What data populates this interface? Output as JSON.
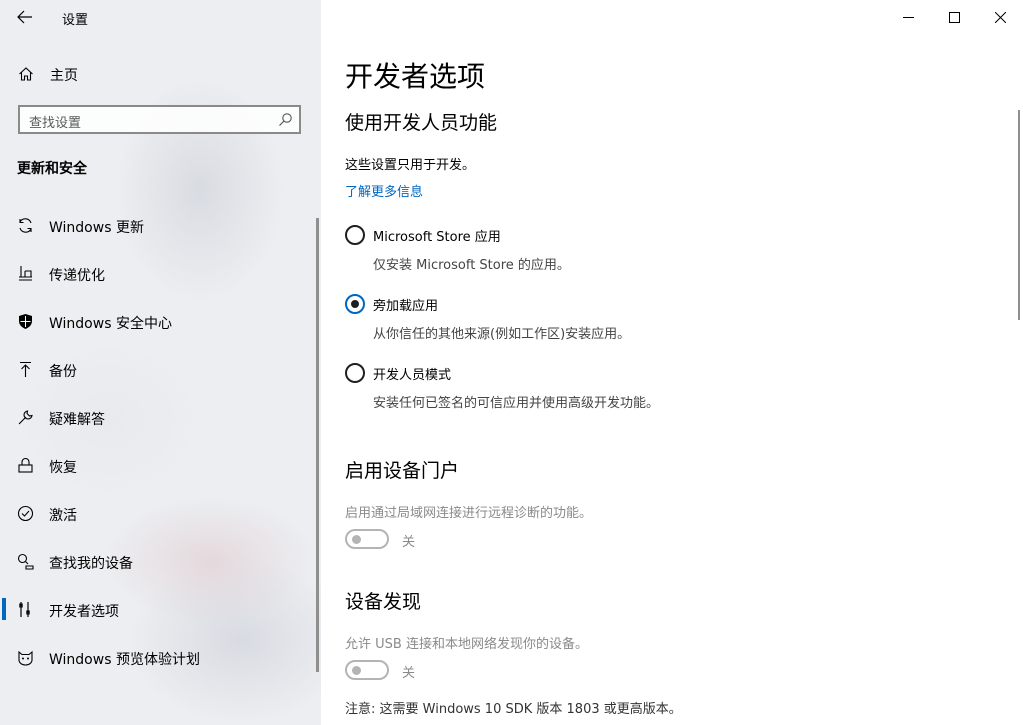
{
  "app": {
    "title": "设置"
  },
  "sidebar": {
    "home_label": "主页",
    "search_placeholder": "查找设置",
    "section_header": "更新和安全",
    "items": [
      {
        "label": "Windows 更新",
        "icon": "refresh-icon"
      },
      {
        "label": "传递优化",
        "icon": "delivery-optimization-icon"
      },
      {
        "label": "Windows 安全中心",
        "icon": "shield-icon"
      },
      {
        "label": "备份",
        "icon": "backup-upload-icon"
      },
      {
        "label": "疑难解答",
        "icon": "wrench-icon"
      },
      {
        "label": "恢复",
        "icon": "recovery-icon"
      },
      {
        "label": "激活",
        "icon": "check-circle-icon"
      },
      {
        "label": "查找我的设备",
        "icon": "find-device-icon"
      },
      {
        "label": "开发者选项",
        "icon": "developer-tools-icon",
        "active": true
      },
      {
        "label": "Windows 预览体验计划",
        "icon": "insider-cat-icon"
      }
    ]
  },
  "main": {
    "page_title": "开发者选项",
    "dev_section": {
      "heading": "使用开发人员功能",
      "description": "这些设置只用于开发。",
      "learn_more": "了解更多信息",
      "options": [
        {
          "label": "Microsoft Store 应用",
          "desc": "仅安装 Microsoft Store 的应用。",
          "checked": false
        },
        {
          "label": "旁加载应用",
          "desc": "从你信任的其他来源(例如工作区)安装应用。",
          "checked": true
        },
        {
          "label": "开发人员模式",
          "desc": "安装任何已签名的可信应用并使用高级开发功能。",
          "checked": false
        }
      ]
    },
    "portal_section": {
      "heading": "启用设备门户",
      "description": "启用通过局域网连接进行远程诊断的功能。",
      "toggle_state": "关"
    },
    "discovery_section": {
      "heading": "设备发现",
      "description": "允许 USB 连接和本地网络发现你的设备。",
      "toggle_state": "关",
      "note": "注意: 这需要 Windows 10 SDK 版本 1803 或更高版本。"
    }
  },
  "colors": {
    "accent": "#0067c0",
    "sidebar_bg": "#eceef1",
    "disabled": "#8a8a8a"
  }
}
